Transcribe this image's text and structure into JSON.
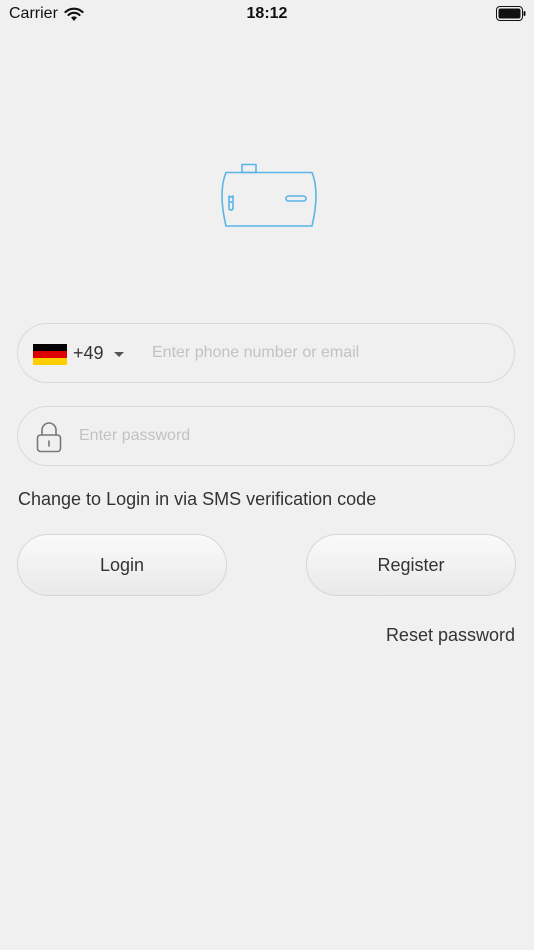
{
  "status_bar": {
    "carrier": "Carrier",
    "time": "18:12",
    "icons": [
      "wifi-icon",
      "battery-icon"
    ]
  },
  "login_form": {
    "country_code": "+49",
    "flag": "germany-flag",
    "phone_placeholder": "Enter phone number or email",
    "phone_value": "",
    "password_placeholder": "Enter password",
    "password_value": "",
    "sms_link": "Change to Login in via SMS verification code",
    "login_label": "Login",
    "register_label": "Register",
    "reset_label": "Reset password"
  },
  "colors": {
    "background": "#f0f0f0",
    "logo_stroke": "#5ab4e5",
    "text": "#333333",
    "placeholder": "#c2c2c2"
  }
}
